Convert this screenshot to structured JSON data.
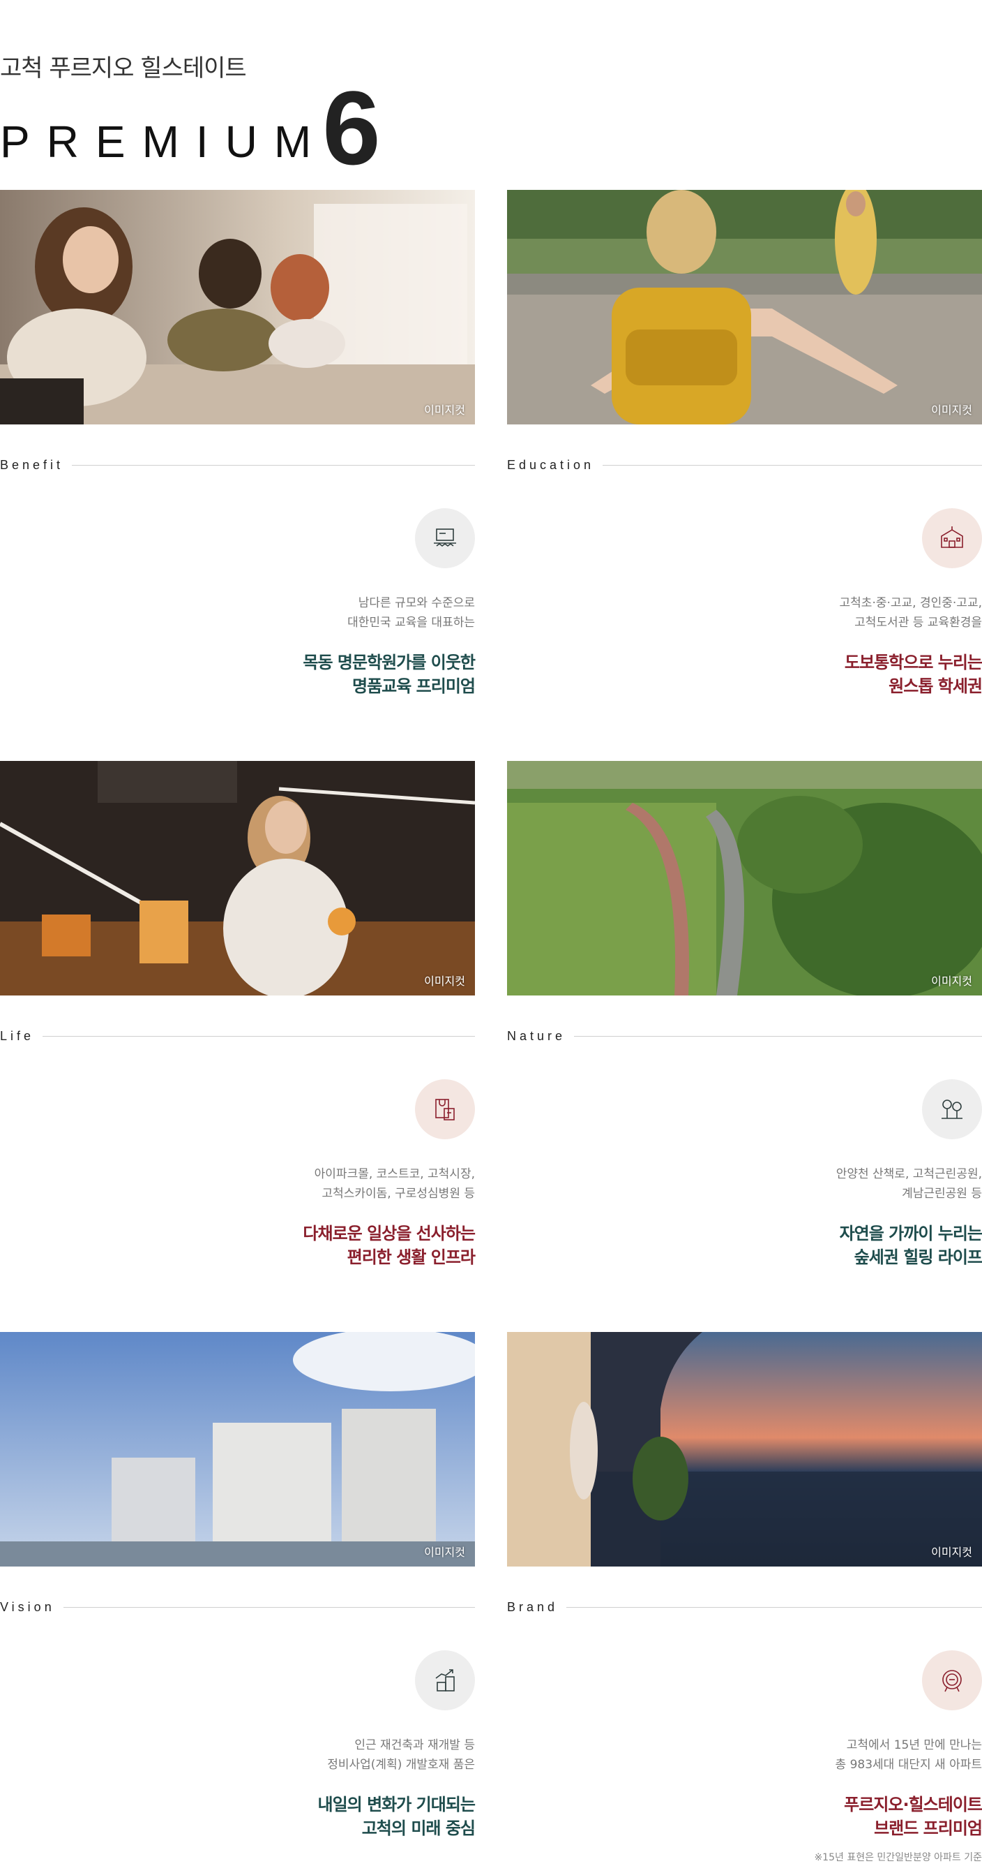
{
  "header": {
    "subtitle": "고척 푸르지오 힐스테이트",
    "premium_word": "PREMIUM",
    "premium_number": "6"
  },
  "image_tag": "이미지컷",
  "cards": [
    {
      "category": "Benefit",
      "icon": "classroom-icon",
      "desc_lines": [
        "남다른 규모와 수준으로",
        "대한민국 교육을 대표하는"
      ],
      "headline_lines": [
        "목동 명문학원가를 이웃한",
        "명품교육 프리미엄"
      ],
      "headline_color": "#1e4c4c",
      "badge_color": "#eeeeee"
    },
    {
      "category": "Education",
      "icon": "school-icon",
      "desc_lines": [
        "고척초·중·고교, 경인중·고교,",
        "고척도서관 등 교육환경을"
      ],
      "headline_lines": [
        "도보통학으로 누리는",
        "원스톱 학세권"
      ],
      "headline_color": "#8a1f2c",
      "badge_color": "#f4e6e1"
    },
    {
      "category": "Life",
      "icon": "shopping-icon",
      "desc_lines": [
        "아이파크몰, 코스트코, 고척시장,",
        "고척스카이돔, 구로성심병원 등"
      ],
      "headline_lines": [
        "다채로운 일상을 선사하는",
        "편리한 생활 인프라"
      ],
      "headline_color": "#8a1f2c",
      "badge_color": "#f4e6e1"
    },
    {
      "category": "Nature",
      "icon": "trees-icon",
      "desc_lines": [
        "안양천 산책로, 고척근린공원,",
        "계남근린공원 등"
      ],
      "headline_lines": [
        "자연을 가까이 누리는",
        "숲세권 힐링 라이프"
      ],
      "headline_color": "#1e4c4c",
      "badge_color": "#eeeeee"
    },
    {
      "category": "Vision",
      "icon": "growth-building-icon",
      "desc_lines": [
        "인근 재건축과 재개발 등",
        "정비사업(계획) 개발호재 품은"
      ],
      "headline_lines": [
        "내일의 변화가 기대되는",
        "고척의 미래 중심"
      ],
      "headline_color": "#1e4c4c",
      "badge_color": "#eeeeee"
    },
    {
      "category": "Brand",
      "icon": "brand-emblem-icon",
      "desc_lines": [
        "고척에서 15년 만에 만나는",
        "총 983세대 대단지 새 아파트"
      ],
      "headline_lines": [
        "푸르지오·힐스테이트",
        "브랜드 프리미엄"
      ],
      "headline_color": "#8a1f2c",
      "badge_color": "#f4e6e1",
      "note": "※15년 표현은 민간일반분양 아파트 기준"
    }
  ]
}
